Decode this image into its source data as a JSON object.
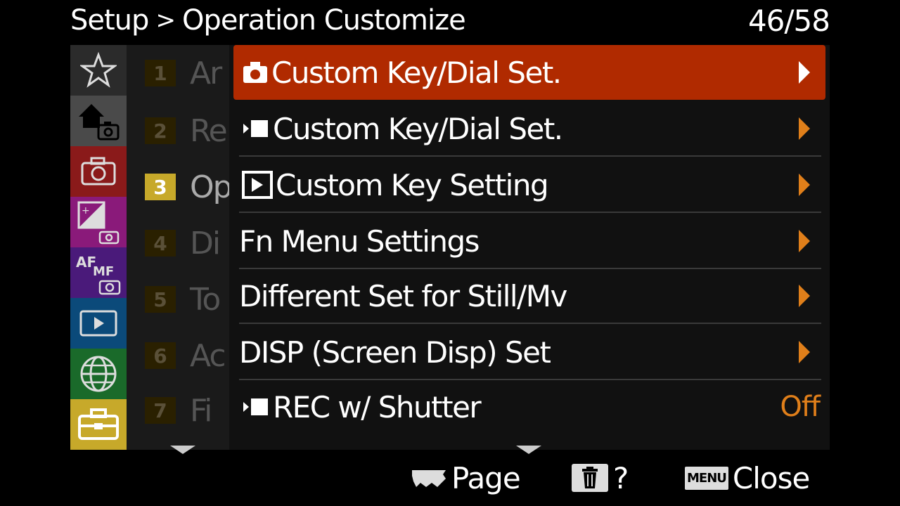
{
  "header": {
    "breadcrumb_root": "Setup",
    "breadcrumb_sep": ">",
    "breadcrumb_current": "Operation Customize",
    "page_counter": "46/58"
  },
  "categories": [
    {
      "name": "star-icon"
    },
    {
      "name": "home-camera-icon"
    },
    {
      "name": "camera-icon"
    },
    {
      "name": "exposure-icon"
    },
    {
      "name": "af-mf-icon"
    },
    {
      "name": "playback-icon"
    },
    {
      "name": "globe-icon"
    },
    {
      "name": "toolbox-icon",
      "active": true
    }
  ],
  "category_colors": [
    "#2b2b2b",
    "#4a4a4a",
    "#8a1a1a",
    "#8a1a7a",
    "#4a1a7a",
    "#0b4a7a",
    "#1a6a2a",
    "#c7a92a"
  ],
  "submenu": [
    {
      "num": "1",
      "label": "Ar"
    },
    {
      "num": "2",
      "label": "Re"
    },
    {
      "num": "3",
      "label": "Op",
      "active": true
    },
    {
      "num": "4",
      "label": "Di"
    },
    {
      "num": "5",
      "label": "To"
    },
    {
      "num": "6",
      "label": "Ac"
    },
    {
      "num": "7",
      "label": "Fi"
    }
  ],
  "menu_items": [
    {
      "icon": "camera-still-icon",
      "label": "Custom Key/Dial Set.",
      "arrow": true,
      "selected": true
    },
    {
      "icon": "movie-icon",
      "label": "Custom Key/Dial Set.",
      "arrow": true
    },
    {
      "icon": "playback-icon",
      "label": "Custom Key Setting",
      "arrow": true
    },
    {
      "icon": "",
      "label": "Fn Menu Settings",
      "arrow": true
    },
    {
      "icon": "",
      "label": "Different Set for Still/Mv",
      "arrow": true
    },
    {
      "icon": "",
      "label": "DISP (Screen Disp) Set",
      "arrow": true
    },
    {
      "icon": "movie-icon",
      "label": "REC w/ Shutter",
      "value": "Off"
    }
  ],
  "footer": {
    "page_label": "Page",
    "help_label": "?",
    "menu_key": "MENU",
    "close_label": "Close"
  },
  "colors": {
    "selected": "#b02a00",
    "accent": "#e07f1a",
    "active_num": "#c7a92a"
  }
}
